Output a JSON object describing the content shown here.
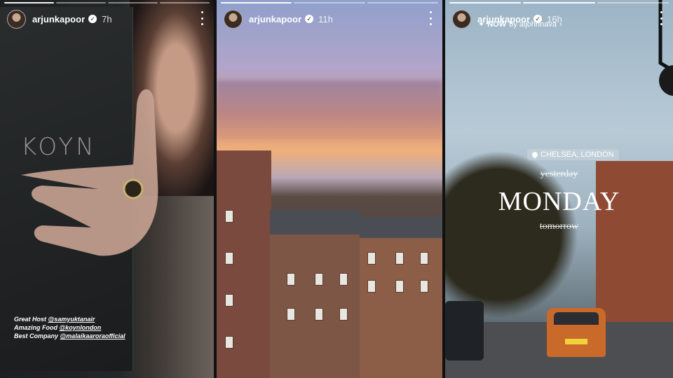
{
  "stories": [
    {
      "username": "arjunkapoor",
      "verified_icon": "verified-badge-icon",
      "time": "7h",
      "progress_segments": 4,
      "progress_done": 1,
      "brand": "KOYN",
      "credits": [
        {
          "label": "Great Host",
          "handle": "@samyuktanair"
        },
        {
          "label": "Amazing Food",
          "handle": "@koynlondon"
        },
        {
          "label": "Best Company",
          "handle": "@malaikaaroraofficial"
        }
      ]
    },
    {
      "username": "arjunkapoor",
      "verified_icon": "verified-badge-icon",
      "time": "11h",
      "progress_segments": 3,
      "progress_done": 1
    },
    {
      "username": "arjunkapoor",
      "verified_icon": "verified-badge-icon",
      "time": "16h",
      "progress_segments": 3,
      "progress_done": 2,
      "music": {
        "now": "NOW",
        "by": "by aljohnnava"
      },
      "location": "CHELSEA, LONDON",
      "day_prev": "yesterday",
      "day": "MONDAY",
      "day_next": "tomorrow"
    }
  ],
  "colors": {
    "car": "#c96a2a",
    "sunset": "#f0b07a"
  }
}
